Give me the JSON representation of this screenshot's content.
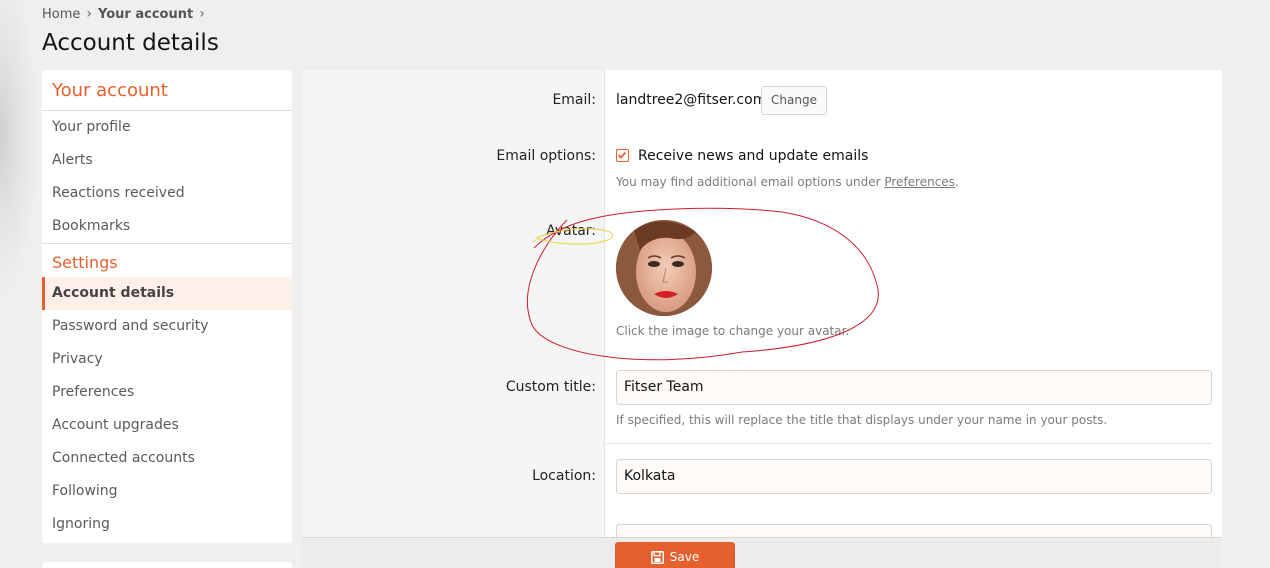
{
  "breadcrumb": {
    "items": [
      "Home",
      "Your account"
    ]
  },
  "page_title": "Account details",
  "sidebar": {
    "account_heading": "Your account",
    "account_items": [
      "Your profile",
      "Alerts",
      "Reactions received",
      "Bookmarks"
    ],
    "settings_heading": "Settings",
    "settings_items": [
      "Account details",
      "Password and security",
      "Privacy",
      "Preferences",
      "Account upgrades",
      "Connected accounts",
      "Following",
      "Ignoring"
    ],
    "active_item": "Account details"
  },
  "form": {
    "email_label": "Email:",
    "email_value": "landtree2@fitser.com",
    "change_button": "Change",
    "email_options_label": "Email options:",
    "receive_news_label": "Receive news and update emails",
    "receive_news_checked": true,
    "email_hint_prefix": "You may find additional email options under",
    "email_hint_link": "Preferences",
    "email_hint_suffix": ".",
    "avatar_label": "Avatar:",
    "avatar_hint": "Click the image to change your avatar.",
    "custom_title_label": "Custom title:",
    "custom_title_value": "Fitser Team",
    "custom_title_hint": "If specified, this will replace the title that displays under your name in your posts.",
    "location_label": "Location:",
    "location_value": "Kolkata"
  },
  "footer": {
    "save_button": "Save"
  },
  "colors": {
    "accent": "#e5602e",
    "annotation_red": "#cc1e28",
    "annotation_yellow": "#e8d23a"
  }
}
